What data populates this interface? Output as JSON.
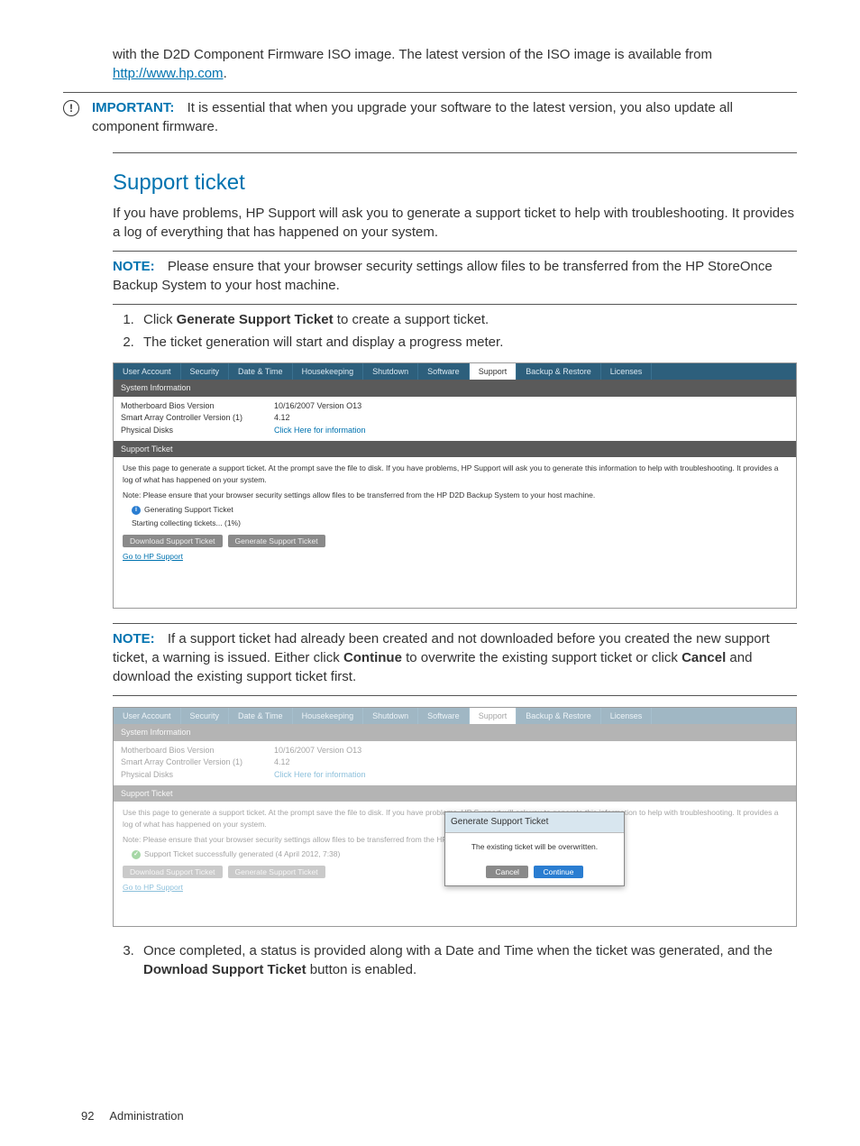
{
  "intro": {
    "para": "with the D2D Component Firmware ISO image. The latest version of the ISO image is available from ",
    "link_text": "http://www.hp.com",
    "link_suffix": "."
  },
  "important": {
    "label": "IMPORTANT:",
    "text": "It is essential that when you upgrade your software to the latest version, you also update all component firmware."
  },
  "section": {
    "heading": "Support ticket",
    "para1": "If you have problems, HP Support will ask you to generate a support ticket to help with troubleshooting. It provides a log of everything that has happened on your system."
  },
  "note1": {
    "label": "NOTE:",
    "text": "Please ensure that your browser security settings allow files to be transferred from the HP StoreOnce Backup System to your host machine."
  },
  "steps": {
    "s1_a": "Click ",
    "s1_b": "Generate Support Ticket",
    "s1_c": " to create a support ticket.",
    "s2": "The ticket generation will start and display a progress meter."
  },
  "note2": {
    "label": "NOTE:",
    "pre": "If a support ticket had already been created and not downloaded before you created the new support ticket, a warning is issued. Either click ",
    "b1": "Continue",
    "mid": " to overwrite the existing support ticket or click ",
    "b2": "Cancel",
    "post": " and download the existing support ticket first."
  },
  "step3": {
    "pre": "Once completed, a status is provided along with a Date and Time when the ticket was generated, and the ",
    "b": "Download Support Ticket",
    "post": " button is enabled."
  },
  "shot": {
    "tabs": [
      "User Account",
      "Security",
      "Date & Time",
      "Housekeeping",
      "Shutdown",
      "Software",
      "Support",
      "Backup & Restore",
      "Licenses"
    ],
    "bar1": "System Information",
    "rows": [
      {
        "k": "Motherboard Bios Version",
        "v": "10/16/2007 Version O13"
      },
      {
        "k": "Smart Array Controller Version (1)",
        "v": "4.12"
      },
      {
        "k": "Physical Disks",
        "v": "Click Here for information"
      }
    ],
    "bar2": "Support Ticket",
    "desc": "Use this page to generate a support ticket. At the prompt save the file to disk. If you have problems, HP Support will ask you to generate this information to help with troubleshooting. It provides a log of what has happened on your system.",
    "note": "Note: Please ensure that your browser security settings allow files to be transferred from the HP D2D Backup System to your host machine.",
    "gen_label": "Generating Support Ticket",
    "progress": "Starting collecting tickets... (1%)",
    "btn_download": "Download Support Ticket",
    "btn_generate": "Generate Support Ticket",
    "go_support": "Go to HP Support"
  },
  "shot2": {
    "success": "Support Ticket successfully generated (4 April 2012, 7:38)",
    "modal_title": "Generate Support Ticket",
    "modal_text": "The existing ticket will be overwritten.",
    "modal_cancel": "Cancel",
    "modal_continue": "Continue"
  },
  "footer": {
    "page": "92",
    "label": "Administration"
  }
}
